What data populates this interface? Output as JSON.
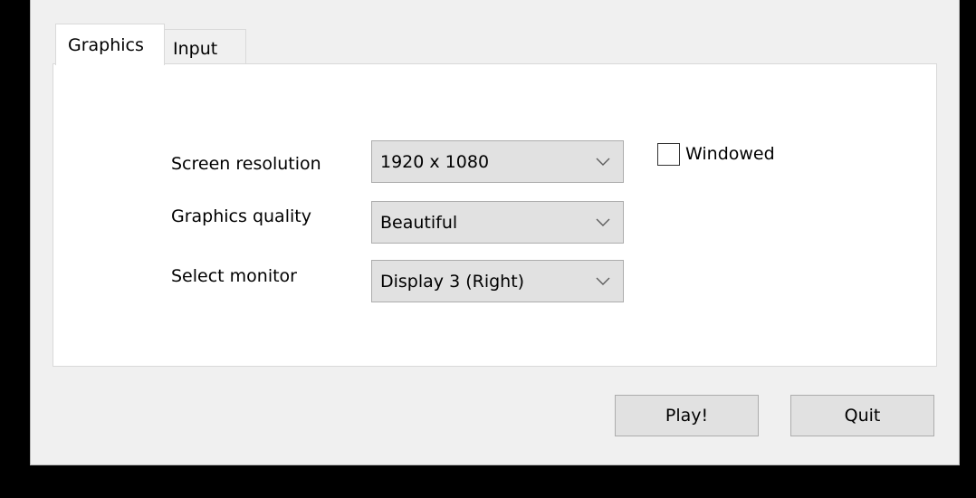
{
  "tabs": [
    {
      "label": "Graphics",
      "selected": true
    },
    {
      "label": "Input",
      "selected": false
    }
  ],
  "settings": {
    "resolution": {
      "label": "Screen resolution",
      "value": "1920 x 1080"
    },
    "quality": {
      "label": "Graphics quality",
      "value": "Beautiful"
    },
    "monitor": {
      "label": "Select monitor",
      "value": "Display 3 (Right)"
    }
  },
  "windowed": {
    "label": "Windowed",
    "checked": false
  },
  "buttons": {
    "play": "Play!",
    "quit": "Quit"
  },
  "icons": {
    "dropdown": "chevron-down-icon"
  },
  "colors": {
    "window_background": "#f0f0f0",
    "panel_background": "#ffffff",
    "control_background": "#e1e1e1",
    "control_border": "#adadad",
    "outer_background": "#000000"
  }
}
